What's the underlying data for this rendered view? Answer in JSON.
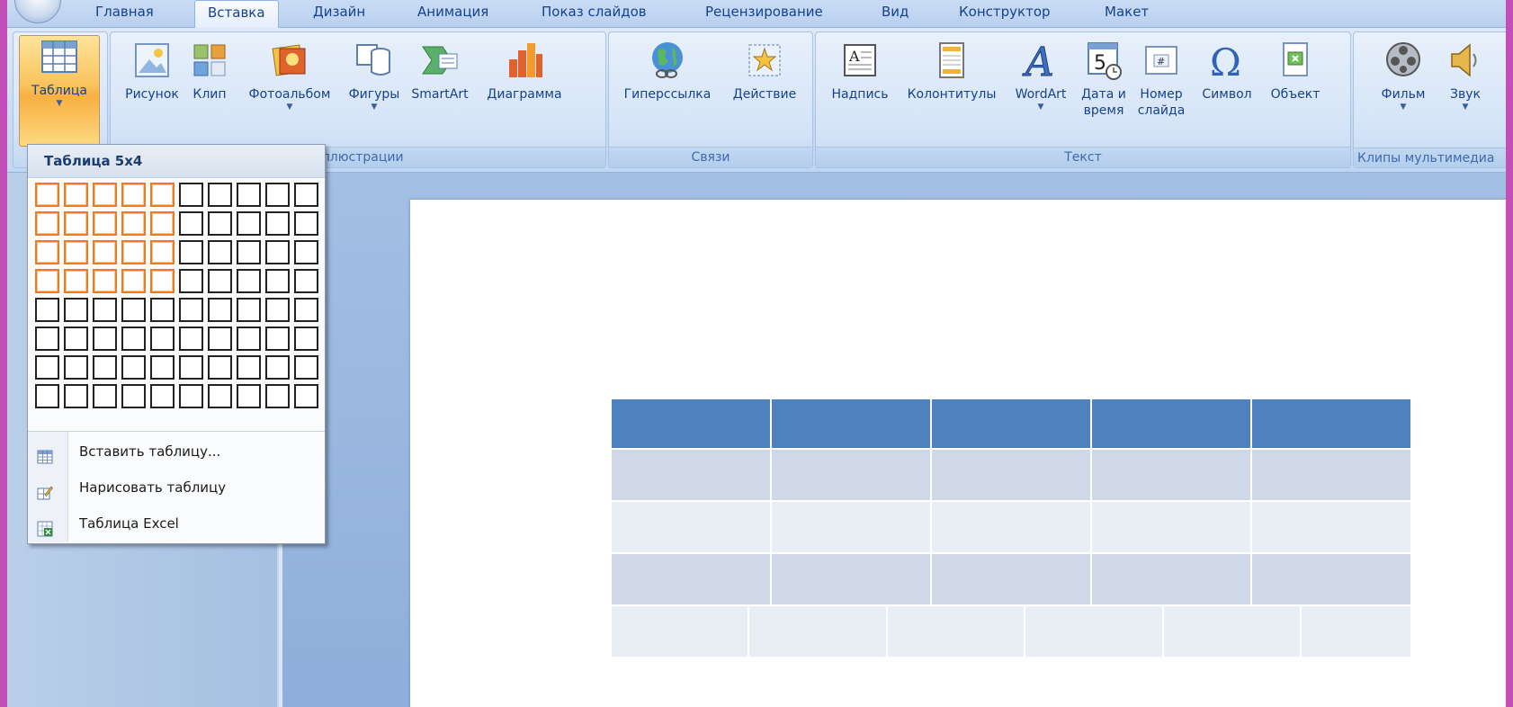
{
  "tabs": [
    "Главная",
    "Вставка",
    "Дизайн",
    "Анимация",
    "Показ слайдов",
    "Рецензирование",
    "Вид",
    "Конструктор",
    "Макет"
  ],
  "active_tab": "Вставка",
  "ribbon": {
    "groups": {
      "illustrations": "Иллюстрации",
      "links": "Связи",
      "text": "Текст",
      "media": "Клипы мультимедиа"
    },
    "buttons": {
      "table": "Таблица",
      "picture": "Рисунок",
      "clip": "Клип",
      "photoalbum": "Фотоальбом",
      "shapes": "Фигуры",
      "smartart": "SmartArt",
      "chart": "Диаграмма",
      "hyperlink": "Гиперссылка",
      "action": "Действие",
      "textbox": "Надпись",
      "headerfooter": "Колонтитулы",
      "wordart": "WordArt",
      "datetime_line1": "Дата и",
      "datetime_line2": "время",
      "slidenum_line1": "Номер",
      "slidenum_line2": "слайда",
      "symbol": "Символ",
      "object": "Объект",
      "movie": "Фильм",
      "sound": "Звук"
    }
  },
  "table_dropdown": {
    "title": "Таблица 5x4",
    "grid_cols": 10,
    "grid_rows": 8,
    "selected_cols": 5,
    "selected_rows": 4,
    "items": [
      {
        "label": "Вставить таблицу...",
        "icon": "insert-table-icon"
      },
      {
        "label": "Нарисовать таблицу",
        "icon": "draw-table-icon"
      },
      {
        "label": "Таблица Excel",
        "icon": "excel-table-icon"
      }
    ]
  },
  "slide_table": {
    "columns": 5,
    "rows": 5,
    "header_color": "#4f81bd",
    "band_dark": "#d0d8e8",
    "band_light": "#e9edf4"
  },
  "colors": {
    "frame": "#c24fb8",
    "ribbon_text": "#15428b",
    "grid_selected": "#ef7a24"
  }
}
